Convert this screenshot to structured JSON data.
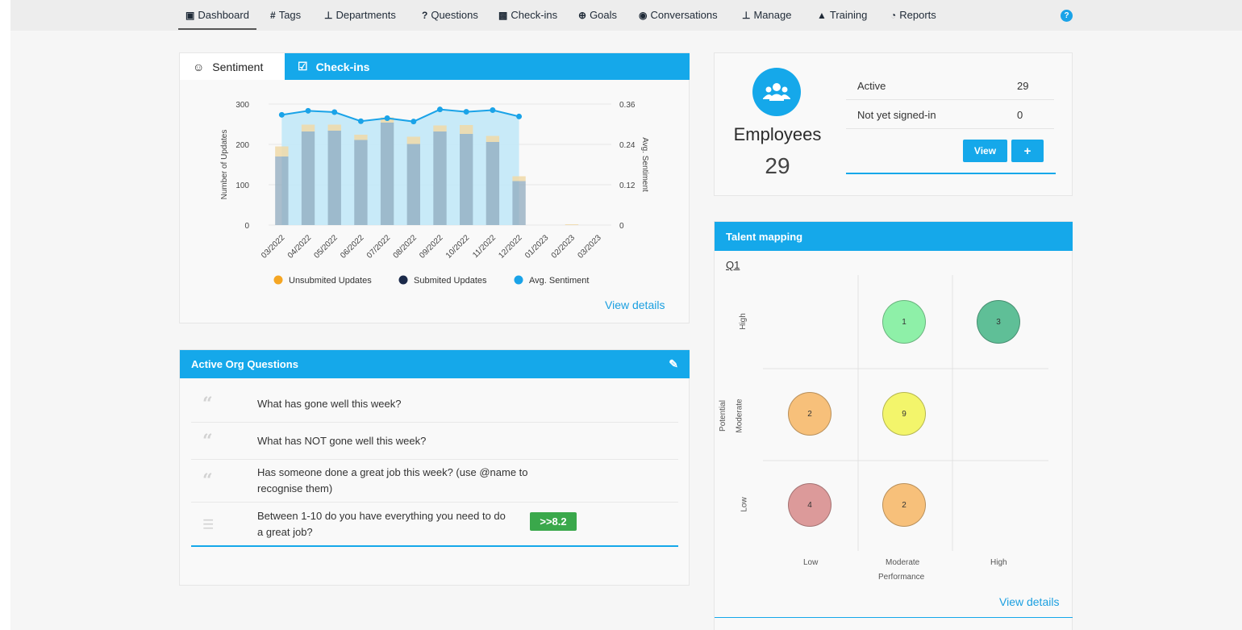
{
  "nav": {
    "items": [
      {
        "label": "Dashboard",
        "icon": "shield-icon"
      },
      {
        "label": "Tags",
        "icon": "hash-icon"
      },
      {
        "label": "Departments",
        "icon": "org-chart-icon"
      },
      {
        "label": "Questions",
        "icon": "question-icon"
      },
      {
        "label": "Check-ins",
        "icon": "clipboard-icon"
      },
      {
        "label": "Goals",
        "icon": "target-icon"
      },
      {
        "label": "Conversations",
        "icon": "chat-icon"
      },
      {
        "label": "Manage",
        "icon": "org-chart-icon"
      },
      {
        "label": "Training",
        "icon": "graduation-cap-icon"
      },
      {
        "label": "Reports",
        "icon": "pie-chart-icon"
      }
    ],
    "help": "?"
  },
  "sentiment_card": {
    "tab_sentiment": "Sentiment",
    "tab_checkins": "Check-ins",
    "view_details": "View details"
  },
  "chart_data": {
    "type": "bar",
    "categories": [
      "03/2022",
      "04/2022",
      "05/2022",
      "06/2022",
      "07/2022",
      "08/2022",
      "09/2022",
      "10/2022",
      "11/2022",
      "12/2022",
      "01/2023",
      "02/2023",
      "03/2023"
    ],
    "series": [
      {
        "name": "Unsubmited Updates",
        "values": [
          25,
          17,
          15,
          13,
          13,
          18,
          15,
          22,
          15,
          12,
          0,
          2,
          0
        ],
        "color": "#f5a623"
      },
      {
        "name": "Submited Updates",
        "values": [
          170,
          232,
          234,
          211,
          254,
          201,
          232,
          226,
          206,
          109,
          0,
          0,
          0
        ],
        "color": "#1b2a4a"
      },
      {
        "name": "Avg. Sentiment",
        "values": [
          0.328,
          0.34,
          0.336,
          0.309,
          0.318,
          0.308,
          0.344,
          0.337,
          0.342,
          0.323
        ],
        "color": "#1aa3e8",
        "axis": "right"
      }
    ],
    "ylabel": "Number of Updates",
    "ylabel_right": "Avg. Sentiment",
    "ylim": [
      0,
      300
    ],
    "yticks": [
      0,
      100,
      200,
      300
    ],
    "ylim_right": [
      0,
      0.36
    ],
    "yticks_right": [
      "0",
      "0.12",
      "0.24",
      "0.36"
    ],
    "legend_position": "bottom"
  },
  "questions_card": {
    "title": "Active Org Questions",
    "items": [
      {
        "text": "What has gone well this week?",
        "icon": "quote-icon"
      },
      {
        "text": "What has NOT gone well this week?",
        "icon": "quote-icon"
      },
      {
        "text": "Has someone done a great job this week? (use @name to recognise them)",
        "icon": "quote-icon"
      },
      {
        "text": "Between 1-10 do you have everything you need to do a great job?",
        "icon": "sliders-icon",
        "score": ">>8.2"
      }
    ]
  },
  "employees_card": {
    "title": "Employees",
    "count": "29",
    "rows": [
      {
        "label": "Active",
        "value": "29"
      },
      {
        "label": "Not yet signed-in",
        "value": "0"
      }
    ],
    "view_button": "View",
    "add_button": "+"
  },
  "talent_card": {
    "title": "Talent mapping",
    "period": "Q1",
    "y_axis_title": "Potential",
    "x_axis_title": "Performance",
    "y_levels": [
      "High",
      "Moderate",
      "Low"
    ],
    "x_levels": [
      "Low",
      "Moderate",
      "High"
    ],
    "bubbles": [
      {
        "potential": "High",
        "performance": "Moderate",
        "count": "1",
        "color": "#8ef0a8"
      },
      {
        "potential": "High",
        "performance": "High",
        "count": "3",
        "color": "#5fbf97"
      },
      {
        "potential": "Moderate",
        "performance": "Low",
        "count": "2",
        "color": "#f7c07a"
      },
      {
        "potential": "Moderate",
        "performance": "Moderate",
        "count": "9",
        "color": "#f3f56b"
      },
      {
        "potential": "Low",
        "performance": "Low",
        "count": "4",
        "color": "#dc9a9a"
      },
      {
        "potential": "Low",
        "performance": "Moderate",
        "count": "2",
        "color": "#f7c07a"
      }
    ],
    "view_details": "View details"
  }
}
